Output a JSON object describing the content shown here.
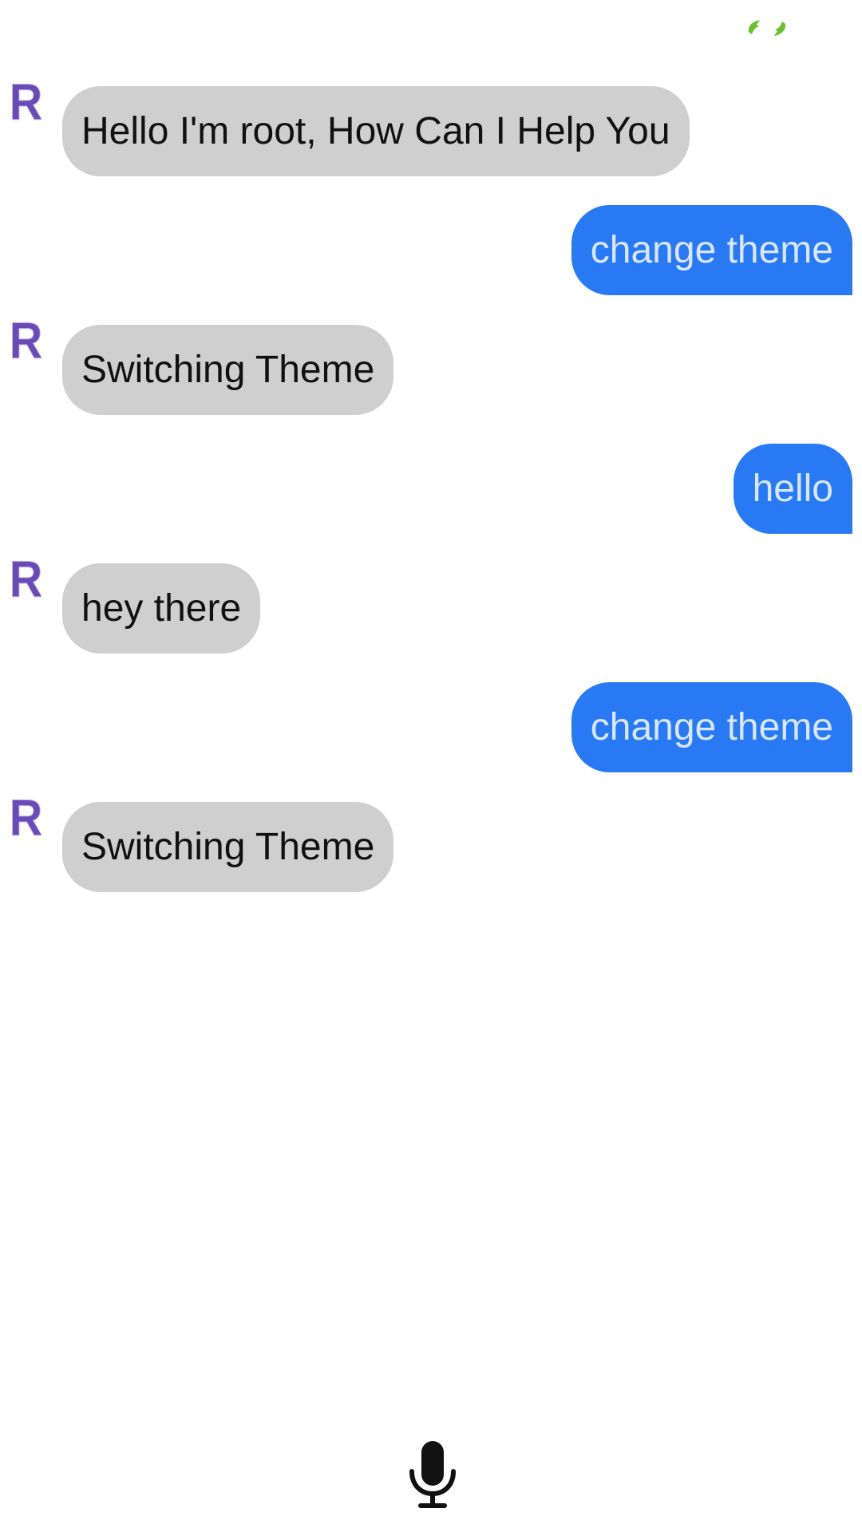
{
  "status": {
    "indicator_icon": "quote-marks-icon",
    "indicator_color": "#6abf2e"
  },
  "chat": {
    "avatar_letter": "R",
    "avatar_color": "#6a4bb5",
    "bot_bubble_color": "#cfcfcf",
    "user_bubble_color": "#2979f5",
    "messages": [
      {
        "from": "bot",
        "text": "Hello I'm root, How Can I Help You"
      },
      {
        "from": "user",
        "text": "change theme"
      },
      {
        "from": "bot",
        "text": "Switching Theme"
      },
      {
        "from": "user",
        "text": "hello"
      },
      {
        "from": "bot",
        "text": "hey there"
      },
      {
        "from": "user",
        "text": "change theme"
      },
      {
        "from": "bot",
        "text": "Switching Theme"
      }
    ]
  },
  "input": {
    "mic_icon": "microphone-icon"
  }
}
